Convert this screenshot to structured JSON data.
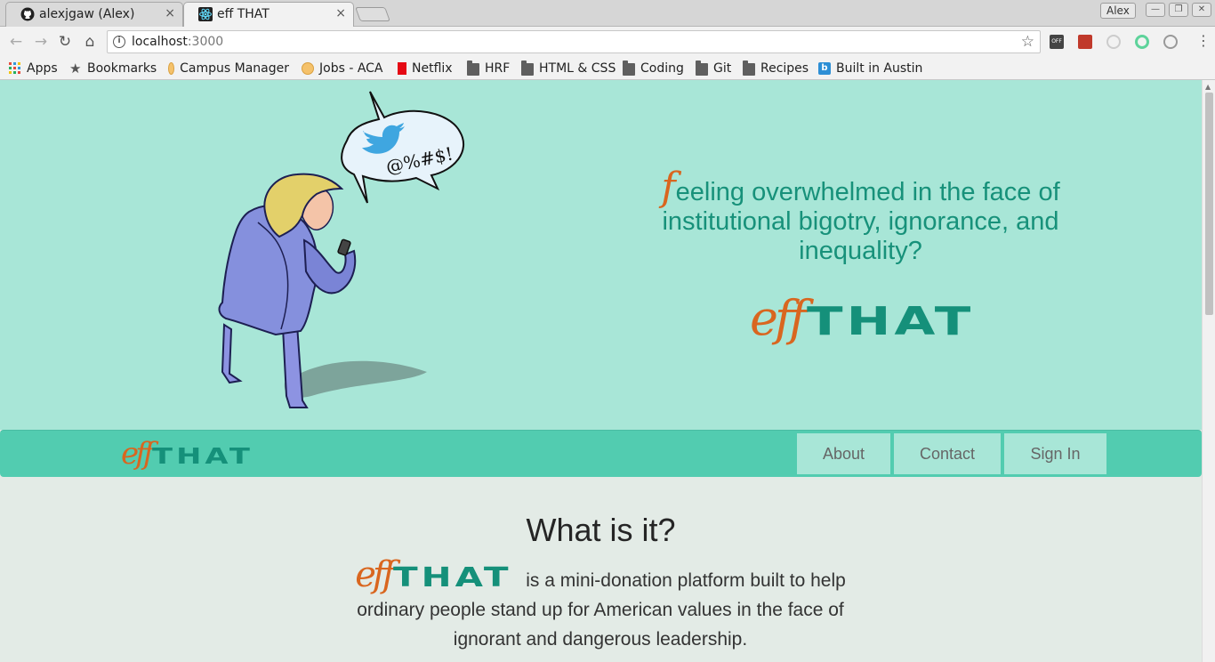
{
  "browser": {
    "tabs": [
      {
        "title": "alexjgaw (Alex)",
        "close": "×"
      },
      {
        "title": "eff THAT",
        "close": "×"
      }
    ],
    "profile_name": "Alex",
    "window_buttons": {
      "minimize": "—",
      "maximize": "❐",
      "close": "✕"
    },
    "url_host": "localhost",
    "url_port": ":3000",
    "bookmarks": [
      {
        "label": "Apps"
      },
      {
        "label": "Bookmarks"
      },
      {
        "label": "Campus Manager"
      },
      {
        "label": "Jobs - ACA"
      },
      {
        "label": "Netflix"
      },
      {
        "label": "HRF"
      },
      {
        "label": "HTML & CSS"
      },
      {
        "label": "Coding"
      },
      {
        "label": "Git"
      },
      {
        "label": "Recipes"
      },
      {
        "label": "Built in Austin"
      }
    ]
  },
  "hero": {
    "speech_text": "@%#$!",
    "headline_first": "f",
    "headline_rest": "eeling overwhelmed in the face of institutional bigotry, ignorance, and inequality?",
    "logo_eff": "eff",
    "logo_that": "THAT"
  },
  "navbar": {
    "logo_eff": "eff",
    "logo_that": "THAT",
    "items": [
      {
        "label": "About"
      },
      {
        "label": "Contact"
      },
      {
        "label": "Sign In"
      }
    ]
  },
  "about": {
    "title": "What is it?",
    "logo_eff": "eff",
    "logo_that": "THAT",
    "text": "is a mini-donation platform built to help ordinary people stand up for American values in the face of ignorant and dangerous leadership."
  },
  "colors": {
    "hero_bg": "#a8e6d7",
    "navbar_bg": "#52ccb0",
    "accent_orange": "#d9661f",
    "accent_teal": "#15907a"
  }
}
